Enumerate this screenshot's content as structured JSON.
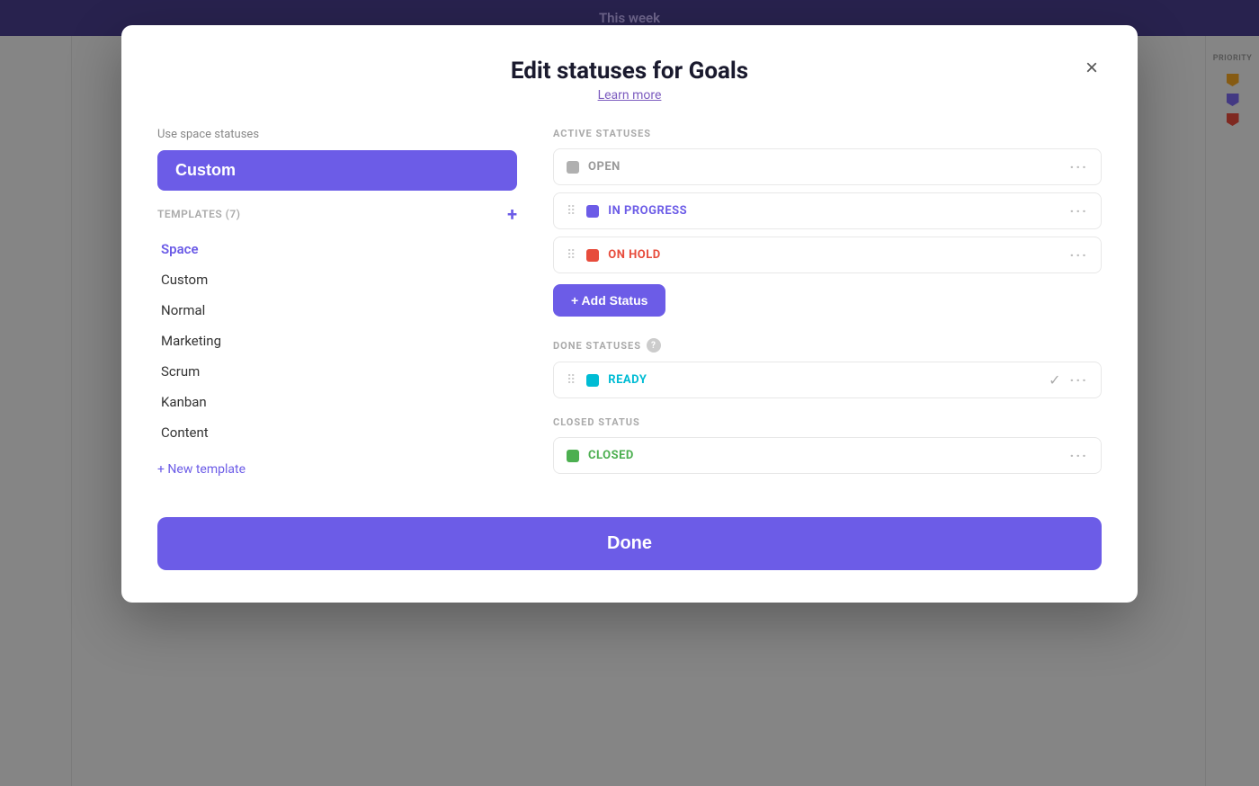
{
  "app": {
    "topbar_title": "This week",
    "priority_label": "PRIORITY"
  },
  "modal": {
    "title": "Edit statuses for Goals",
    "learn_more": "Learn more",
    "close_label": "×",
    "use_space_label": "Use space statuses",
    "custom_selected": "Custom",
    "templates_label": "TEMPLATES (7)",
    "templates_add": "+",
    "template_items": [
      {
        "label": "Space",
        "active": true
      },
      {
        "label": "Custom",
        "active": false
      },
      {
        "label": "Normal",
        "active": false
      },
      {
        "label": "Marketing",
        "active": false
      },
      {
        "label": "Scrum",
        "active": false
      },
      {
        "label": "Kanban",
        "active": false
      },
      {
        "label": "Content",
        "active": false
      }
    ],
    "new_template": "+ New template",
    "active_statuses_label": "ACTIVE STATUSES",
    "done_statuses_label": "DONE STATUSES",
    "closed_status_label": "CLOSED STATUS",
    "statuses_active": [
      {
        "name": "OPEN",
        "color": "gray"
      },
      {
        "name": "IN PROGRESS",
        "color": "blue-purple"
      },
      {
        "name": "ON HOLD",
        "color": "red"
      }
    ],
    "statuses_done": [
      {
        "name": "READY",
        "color": "cyan",
        "check": true
      }
    ],
    "statuses_closed": [
      {
        "name": "CLOSED",
        "color": "green"
      }
    ],
    "add_status_label": "+ Add Status",
    "done_button_label": "Done"
  }
}
